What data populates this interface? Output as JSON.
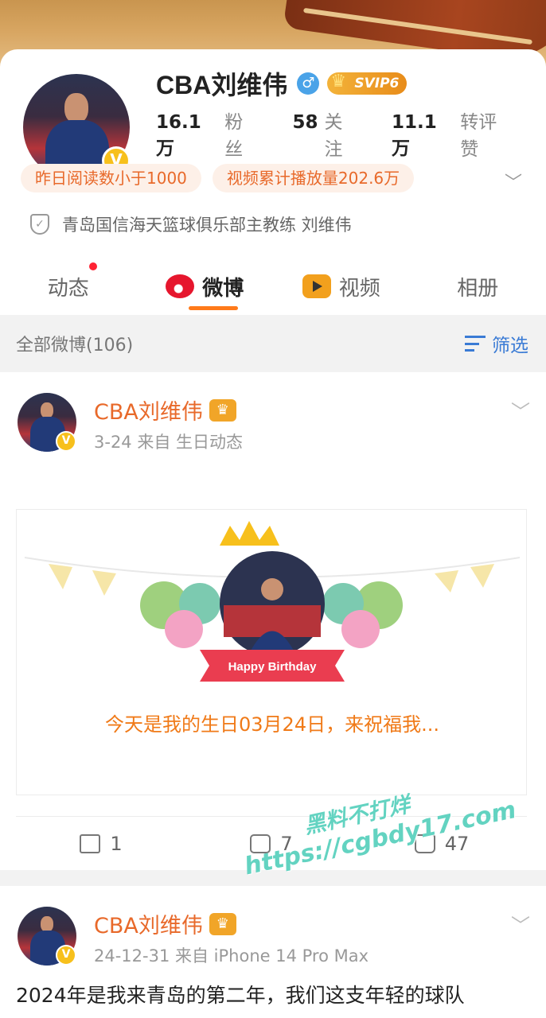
{
  "profile": {
    "name": "CBA刘维伟",
    "gender_icon": "♂",
    "svip_label": "SVIP6",
    "verified_icon": "V",
    "stats": [
      {
        "num": "16.1万",
        "label": "粉丝"
      },
      {
        "num": "58",
        "label": "关注"
      },
      {
        "num": "11.1万",
        "label": "转评赞"
      }
    ],
    "tags": [
      "昨日阅读数小于1000",
      "视频累计播放量202.6万"
    ],
    "description": "青岛国信海天篮球俱乐部主教练 刘维伟"
  },
  "tabs": [
    {
      "label": "动态",
      "icon": null,
      "badge_dot": true
    },
    {
      "label": "微博",
      "icon": "weibo-icon",
      "active": true
    },
    {
      "label": "视频",
      "icon": "video-icon"
    },
    {
      "label": "相册",
      "icon": null
    }
  ],
  "filterbar": {
    "count_label": "全部微博(106)",
    "filter_label": "筛选"
  },
  "posts": [
    {
      "author": "CBA刘维伟",
      "meta": "3-24   来自 生日动态",
      "card": {
        "banner_text": "Happy Birthday",
        "text": "今天是我的生日03月24日，来祝福我..."
      },
      "actions": {
        "repost": "1",
        "comment": "7",
        "like": "47"
      }
    },
    {
      "author": "CBA刘维伟",
      "meta": "24-12-31   来自 iPhone 14 Pro Max",
      "text": "2024年是我来青岛的第二年，我们这支年轻的球队"
    }
  ],
  "watermark": {
    "line1": "黑料不打烊",
    "line2": "https://cgbdy17.com"
  },
  "colors": {
    "accent_orange": "#e8692a",
    "link_blue": "#3a7bd5",
    "verified_gold": "#f7c01c"
  }
}
